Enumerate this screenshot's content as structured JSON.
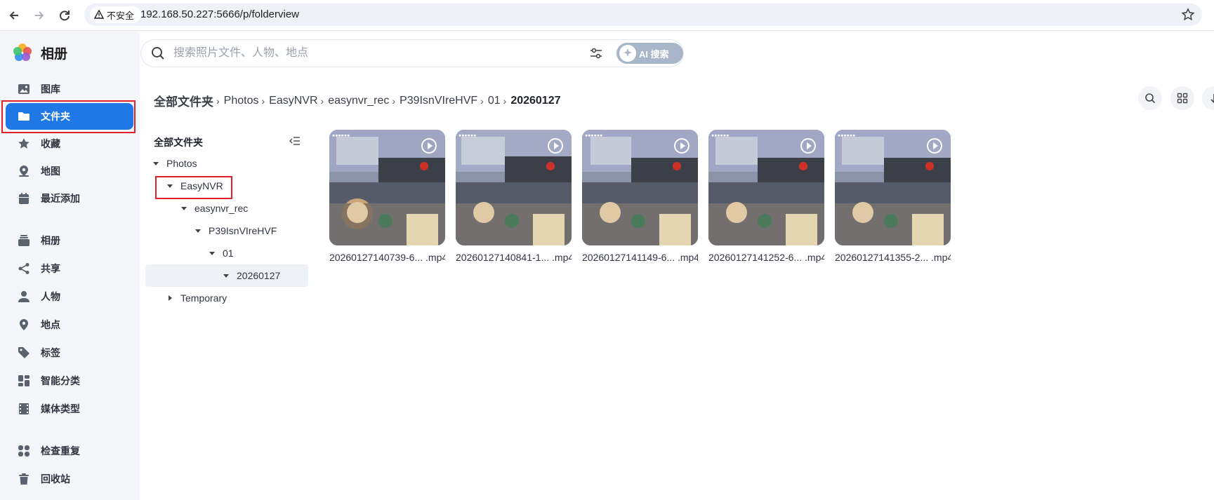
{
  "browser": {
    "security_label": "不安全",
    "url": "192.168.50.227:5666/p/folderview"
  },
  "app": {
    "title": "相册"
  },
  "sidebar": {
    "items": [
      {
        "label": "图库",
        "icon": "image-icon"
      },
      {
        "label": "文件夹",
        "icon": "folder-icon",
        "active": true
      },
      {
        "label": "收藏",
        "icon": "star-icon"
      },
      {
        "label": "地图",
        "icon": "map-icon"
      },
      {
        "label": "最近添加",
        "icon": "calendar-icon"
      },
      {
        "label": "相册",
        "icon": "album-icon"
      },
      {
        "label": "共享",
        "icon": "share-icon"
      },
      {
        "label": "人物",
        "icon": "person-icon"
      },
      {
        "label": "地点",
        "icon": "location-pin-icon"
      },
      {
        "label": "标签",
        "icon": "tag-icon"
      },
      {
        "label": "智能分类",
        "icon": "grid-category-icon"
      },
      {
        "label": "媒体类型",
        "icon": "film-icon"
      },
      {
        "label": "检查重复",
        "icon": "duplicate-icon"
      },
      {
        "label": "回收站",
        "icon": "trash-icon"
      }
    ]
  },
  "search": {
    "placeholder": "搜索照片文件、人物、地点",
    "ai_label": "AI 搜索"
  },
  "breadcrumb": [
    "全部文件夹",
    "Photos",
    "EasyNVR",
    "easynvr_rec",
    "P39IsnVIreHVF",
    "01",
    "20260127"
  ],
  "tree": {
    "header": "全部文件夹",
    "nodes": [
      {
        "label": "Photos",
        "level": 0,
        "expanded": true
      },
      {
        "label": "EasyNVR",
        "level": 1,
        "expanded": true,
        "highlighted": true
      },
      {
        "label": "easynvr_rec",
        "level": 2,
        "expanded": true
      },
      {
        "label": "P39IsnVIreHVF",
        "level": 3,
        "expanded": true
      },
      {
        "label": "01",
        "level": 4,
        "expanded": true
      },
      {
        "label": "20260127",
        "level": 5,
        "expanded": true,
        "selected": true
      },
      {
        "label": "Temporary",
        "level": 1,
        "expanded": false
      }
    ]
  },
  "files": [
    {
      "name": "20260127140739-6... .mp4",
      "type": "video"
    },
    {
      "name": "20260127140841-1... .mp4",
      "type": "video"
    },
    {
      "name": "20260127141149-6... .mp4",
      "type": "video"
    },
    {
      "name": "20260127141252-6... .mp4",
      "type": "video"
    },
    {
      "name": "20260127141355-2... .mp4",
      "type": "video"
    }
  ],
  "colors": {
    "accent": "#1f78e6",
    "highlight_box": "#e0202a",
    "sidebar_bg": "#f4f6f9",
    "selected_row": "#eef2f8"
  }
}
